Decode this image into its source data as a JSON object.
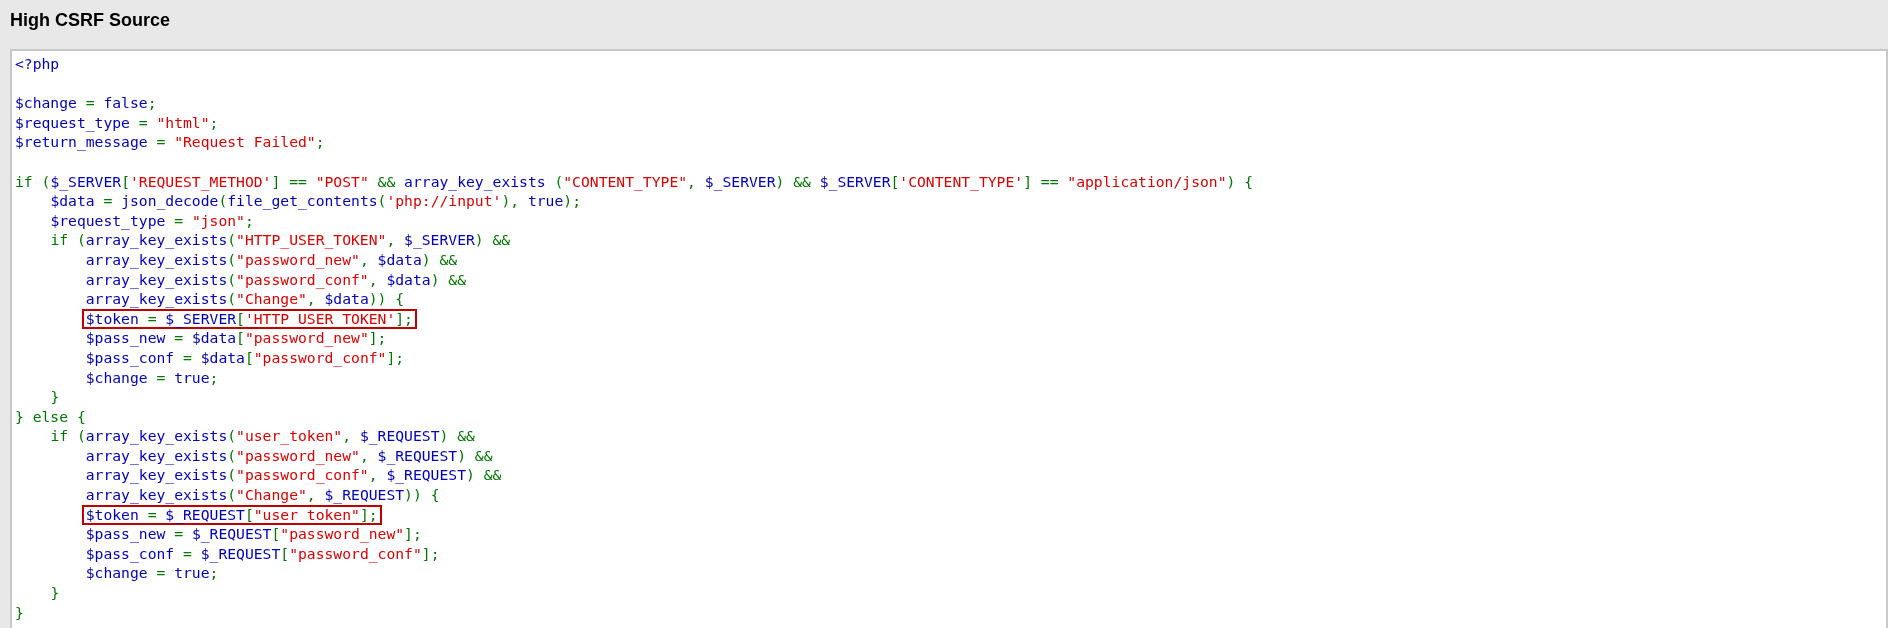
{
  "header": {
    "title": "High CSRF Source"
  },
  "code": {
    "lines": [
      {
        "kind": "code",
        "tokens": [
          {
            "kind": "id",
            "text": "<?php"
          }
        ]
      },
      {
        "kind": "blank"
      },
      {
        "kind": "code",
        "tokens": [
          {
            "kind": "id",
            "text": "$change"
          },
          {
            "kind": "kw",
            "text": " = "
          },
          {
            "kind": "id",
            "text": "false"
          },
          {
            "kind": "kw",
            "text": ";"
          }
        ]
      },
      {
        "kind": "code",
        "tokens": [
          {
            "kind": "id",
            "text": "$request_type"
          },
          {
            "kind": "kw",
            "text": " = "
          },
          {
            "kind": "str",
            "text": "\"html\""
          },
          {
            "kind": "kw",
            "text": ";"
          }
        ]
      },
      {
        "kind": "code",
        "tokens": [
          {
            "kind": "id",
            "text": "$return_message"
          },
          {
            "kind": "kw",
            "text": " = "
          },
          {
            "kind": "str",
            "text": "\"Request Failed\""
          },
          {
            "kind": "kw",
            "text": ";"
          }
        ]
      },
      {
        "kind": "blank"
      },
      {
        "kind": "code",
        "tokens": [
          {
            "kind": "kw",
            "text": "if ("
          },
          {
            "kind": "id",
            "text": "$_SERVER"
          },
          {
            "kind": "kw",
            "text": "["
          },
          {
            "kind": "str",
            "text": "'REQUEST_METHOD'"
          },
          {
            "kind": "kw",
            "text": "] == "
          },
          {
            "kind": "str",
            "text": "\"POST\""
          },
          {
            "kind": "kw",
            "text": " && "
          },
          {
            "kind": "id",
            "text": "array_key_exists "
          },
          {
            "kind": "kw",
            "text": "("
          },
          {
            "kind": "str",
            "text": "\"CONTENT_TYPE\""
          },
          {
            "kind": "kw",
            "text": ", "
          },
          {
            "kind": "id",
            "text": "$_SERVER"
          },
          {
            "kind": "kw",
            "text": ") && "
          },
          {
            "kind": "id",
            "text": "$_SERVER"
          },
          {
            "kind": "kw",
            "text": "["
          },
          {
            "kind": "str",
            "text": "'CONTENT_TYPE'"
          },
          {
            "kind": "kw",
            "text": "] == "
          },
          {
            "kind": "str",
            "text": "\"application/json\""
          },
          {
            "kind": "kw",
            "text": ") {"
          }
        ]
      },
      {
        "kind": "code",
        "tokens": [
          {
            "kind": "id",
            "text": "    $data"
          },
          {
            "kind": "kw",
            "text": " = "
          },
          {
            "kind": "id",
            "text": "json_decode"
          },
          {
            "kind": "kw",
            "text": "("
          },
          {
            "kind": "id",
            "text": "file_get_contents"
          },
          {
            "kind": "kw",
            "text": "("
          },
          {
            "kind": "str",
            "text": "'php://input'"
          },
          {
            "kind": "kw",
            "text": "), "
          },
          {
            "kind": "id",
            "text": "true"
          },
          {
            "kind": "kw",
            "text": ");"
          }
        ]
      },
      {
        "kind": "code",
        "tokens": [
          {
            "kind": "id",
            "text": "    $request_type"
          },
          {
            "kind": "kw",
            "text": " = "
          },
          {
            "kind": "str",
            "text": "\"json\""
          },
          {
            "kind": "kw",
            "text": ";"
          }
        ]
      },
      {
        "kind": "code",
        "tokens": [
          {
            "kind": "kw",
            "text": "    if ("
          },
          {
            "kind": "id",
            "text": "array_key_exists"
          },
          {
            "kind": "kw",
            "text": "("
          },
          {
            "kind": "str",
            "text": "\"HTTP_USER_TOKEN\""
          },
          {
            "kind": "kw",
            "text": ", "
          },
          {
            "kind": "id",
            "text": "$_SERVER"
          },
          {
            "kind": "kw",
            "text": ") &&"
          }
        ]
      },
      {
        "kind": "code",
        "tokens": [
          {
            "kind": "id",
            "text": "        array_key_exists"
          },
          {
            "kind": "kw",
            "text": "("
          },
          {
            "kind": "str",
            "text": "\"password_new\""
          },
          {
            "kind": "kw",
            "text": ", "
          },
          {
            "kind": "id",
            "text": "$data"
          },
          {
            "kind": "kw",
            "text": ") &&"
          }
        ]
      },
      {
        "kind": "code",
        "tokens": [
          {
            "kind": "id",
            "text": "        array_key_exists"
          },
          {
            "kind": "kw",
            "text": "("
          },
          {
            "kind": "str",
            "text": "\"password_conf\""
          },
          {
            "kind": "kw",
            "text": ", "
          },
          {
            "kind": "id",
            "text": "$data"
          },
          {
            "kind": "kw",
            "text": ") &&"
          }
        ]
      },
      {
        "kind": "code",
        "tokens": [
          {
            "kind": "id",
            "text": "        array_key_exists"
          },
          {
            "kind": "kw",
            "text": "("
          },
          {
            "kind": "str",
            "text": "\"Change\""
          },
          {
            "kind": "kw",
            "text": ", "
          },
          {
            "kind": "id",
            "text": "$data"
          },
          {
            "kind": "kw",
            "text": ")) {"
          }
        ]
      },
      {
        "kind": "code",
        "boxed": true,
        "tokens": [
          {
            "kind": "id",
            "text": "        $token"
          },
          {
            "kind": "kw",
            "text": " = "
          },
          {
            "kind": "id",
            "text": "$_SERVER"
          },
          {
            "kind": "kw",
            "text": "["
          },
          {
            "kind": "str",
            "text": "'HTTP_USER_TOKEN'"
          },
          {
            "kind": "kw",
            "text": "];"
          }
        ]
      },
      {
        "kind": "code",
        "tokens": [
          {
            "kind": "id",
            "text": "        $pass_new"
          },
          {
            "kind": "kw",
            "text": " = "
          },
          {
            "kind": "id",
            "text": "$data"
          },
          {
            "kind": "kw",
            "text": "["
          },
          {
            "kind": "str",
            "text": "\"password_new\""
          },
          {
            "kind": "kw",
            "text": "];"
          }
        ]
      },
      {
        "kind": "code",
        "tokens": [
          {
            "kind": "id",
            "text": "        $pass_conf"
          },
          {
            "kind": "kw",
            "text": " = "
          },
          {
            "kind": "id",
            "text": "$data"
          },
          {
            "kind": "kw",
            "text": "["
          },
          {
            "kind": "str",
            "text": "\"password_conf\""
          },
          {
            "kind": "kw",
            "text": "];"
          }
        ]
      },
      {
        "kind": "code",
        "tokens": [
          {
            "kind": "id",
            "text": "        $change"
          },
          {
            "kind": "kw",
            "text": " = "
          },
          {
            "kind": "id",
            "text": "true"
          },
          {
            "kind": "kw",
            "text": ";"
          }
        ]
      },
      {
        "kind": "code",
        "tokens": [
          {
            "kind": "kw",
            "text": "    }"
          }
        ]
      },
      {
        "kind": "code",
        "tokens": [
          {
            "kind": "kw",
            "text": "} else {"
          }
        ]
      },
      {
        "kind": "code",
        "tokens": [
          {
            "kind": "kw",
            "text": "    if ("
          },
          {
            "kind": "id",
            "text": "array_key_exists"
          },
          {
            "kind": "kw",
            "text": "("
          },
          {
            "kind": "str",
            "text": "\"user_token\""
          },
          {
            "kind": "kw",
            "text": ", "
          },
          {
            "kind": "id",
            "text": "$_REQUEST"
          },
          {
            "kind": "kw",
            "text": ") &&"
          }
        ]
      },
      {
        "kind": "code",
        "tokens": [
          {
            "kind": "id",
            "text": "        array_key_exists"
          },
          {
            "kind": "kw",
            "text": "("
          },
          {
            "kind": "str",
            "text": "\"password_new\""
          },
          {
            "kind": "kw",
            "text": ", "
          },
          {
            "kind": "id",
            "text": "$_REQUEST"
          },
          {
            "kind": "kw",
            "text": ") &&"
          }
        ]
      },
      {
        "kind": "code",
        "tokens": [
          {
            "kind": "id",
            "text": "        array_key_exists"
          },
          {
            "kind": "kw",
            "text": "("
          },
          {
            "kind": "str",
            "text": "\"password_conf\""
          },
          {
            "kind": "kw",
            "text": ", "
          },
          {
            "kind": "id",
            "text": "$_REQUEST"
          },
          {
            "kind": "kw",
            "text": ") &&"
          }
        ]
      },
      {
        "kind": "code",
        "tokens": [
          {
            "kind": "id",
            "text": "        array_key_exists"
          },
          {
            "kind": "kw",
            "text": "("
          },
          {
            "kind": "str",
            "text": "\"Change\""
          },
          {
            "kind": "kw",
            "text": ", "
          },
          {
            "kind": "id",
            "text": "$_REQUEST"
          },
          {
            "kind": "kw",
            "text": ")) {"
          }
        ]
      },
      {
        "kind": "code",
        "boxed": true,
        "tokens": [
          {
            "kind": "id",
            "text": "        $token"
          },
          {
            "kind": "kw",
            "text": " = "
          },
          {
            "kind": "id",
            "text": "$_REQUEST"
          },
          {
            "kind": "kw",
            "text": "["
          },
          {
            "kind": "str",
            "text": "\"user_token\""
          },
          {
            "kind": "kw",
            "text": "];"
          }
        ]
      },
      {
        "kind": "code",
        "tokens": [
          {
            "kind": "id",
            "text": "        $pass_new"
          },
          {
            "kind": "kw",
            "text": " = "
          },
          {
            "kind": "id",
            "text": "$_REQUEST"
          },
          {
            "kind": "kw",
            "text": "["
          },
          {
            "kind": "str",
            "text": "\"password_new\""
          },
          {
            "kind": "kw",
            "text": "];"
          }
        ]
      },
      {
        "kind": "code",
        "tokens": [
          {
            "kind": "id",
            "text": "        $pass_conf"
          },
          {
            "kind": "kw",
            "text": " = "
          },
          {
            "kind": "id",
            "text": "$_REQUEST"
          },
          {
            "kind": "kw",
            "text": "["
          },
          {
            "kind": "str",
            "text": "\"password_conf\""
          },
          {
            "kind": "kw",
            "text": "];"
          }
        ]
      },
      {
        "kind": "code",
        "tokens": [
          {
            "kind": "id",
            "text": "        $change"
          },
          {
            "kind": "kw",
            "text": " = "
          },
          {
            "kind": "id",
            "text": "true"
          },
          {
            "kind": "kw",
            "text": ";"
          }
        ]
      },
      {
        "kind": "code",
        "tokens": [
          {
            "kind": "kw",
            "text": "    }"
          }
        ]
      },
      {
        "kind": "code",
        "tokens": [
          {
            "kind": "kw",
            "text": "}"
          }
        ]
      }
    ]
  }
}
